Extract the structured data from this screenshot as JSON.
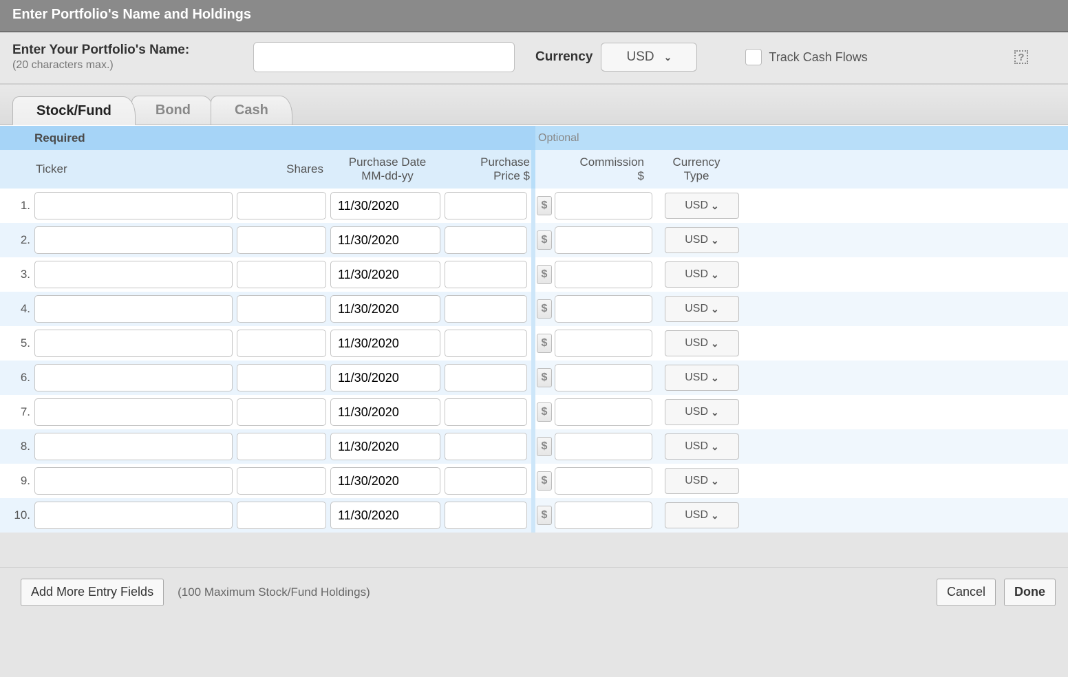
{
  "title": "Enter Portfolio's Name and Holdings",
  "header": {
    "name_label": "Enter Your Portfolio's Name:",
    "name_sublabel": "(20 characters max.)",
    "name_value": "",
    "currency_label": "Currency",
    "currency_value": "USD",
    "track_label": "Track Cash Flows",
    "help_icon": "?"
  },
  "tabs": [
    {
      "label": "Stock/Fund",
      "active": true
    },
    {
      "label": "Bond",
      "active": false
    },
    {
      "label": "Cash",
      "active": false
    }
  ],
  "sections": {
    "required_label": "Required",
    "optional_label": "Optional"
  },
  "columns": {
    "ticker": "Ticker",
    "shares": "Shares",
    "purchase_date_l1": "Purchase Date",
    "purchase_date_l2": "MM-dd-yy",
    "purchase_price_l1": "Purchase",
    "purchase_price_l2": "Price $",
    "commission_l1": "Commission",
    "commission_l2": "$",
    "currency_type_l1": "Currency",
    "currency_type_l2": "Type"
  },
  "default_currency_row": "USD",
  "dollar_glyph": "$",
  "rows": [
    {
      "n": "1.",
      "ticker": "",
      "shares": "",
      "date": "11/30/2020",
      "price": "",
      "commission": "",
      "currency": "USD"
    },
    {
      "n": "2.",
      "ticker": "",
      "shares": "",
      "date": "11/30/2020",
      "price": "",
      "commission": "",
      "currency": "USD"
    },
    {
      "n": "3.",
      "ticker": "",
      "shares": "",
      "date": "11/30/2020",
      "price": "",
      "commission": "",
      "currency": "USD"
    },
    {
      "n": "4.",
      "ticker": "",
      "shares": "",
      "date": "11/30/2020",
      "price": "",
      "commission": "",
      "currency": "USD"
    },
    {
      "n": "5.",
      "ticker": "",
      "shares": "",
      "date": "11/30/2020",
      "price": "",
      "commission": "",
      "currency": "USD"
    },
    {
      "n": "6.",
      "ticker": "",
      "shares": "",
      "date": "11/30/2020",
      "price": "",
      "commission": "",
      "currency": "USD"
    },
    {
      "n": "7.",
      "ticker": "",
      "shares": "",
      "date": "11/30/2020",
      "price": "",
      "commission": "",
      "currency": "USD"
    },
    {
      "n": "8.",
      "ticker": "",
      "shares": "",
      "date": "11/30/2020",
      "price": "",
      "commission": "",
      "currency": "USD"
    },
    {
      "n": "9.",
      "ticker": "",
      "shares": "",
      "date": "11/30/2020",
      "price": "",
      "commission": "",
      "currency": "USD"
    },
    {
      "n": "10.",
      "ticker": "",
      "shares": "",
      "date": "11/30/2020",
      "price": "",
      "commission": "",
      "currency": "USD"
    }
  ],
  "footer": {
    "add_more": "Add More Entry Fields",
    "max_note": "(100 Maximum Stock/Fund Holdings)",
    "cancel": "Cancel",
    "done": "Done"
  }
}
